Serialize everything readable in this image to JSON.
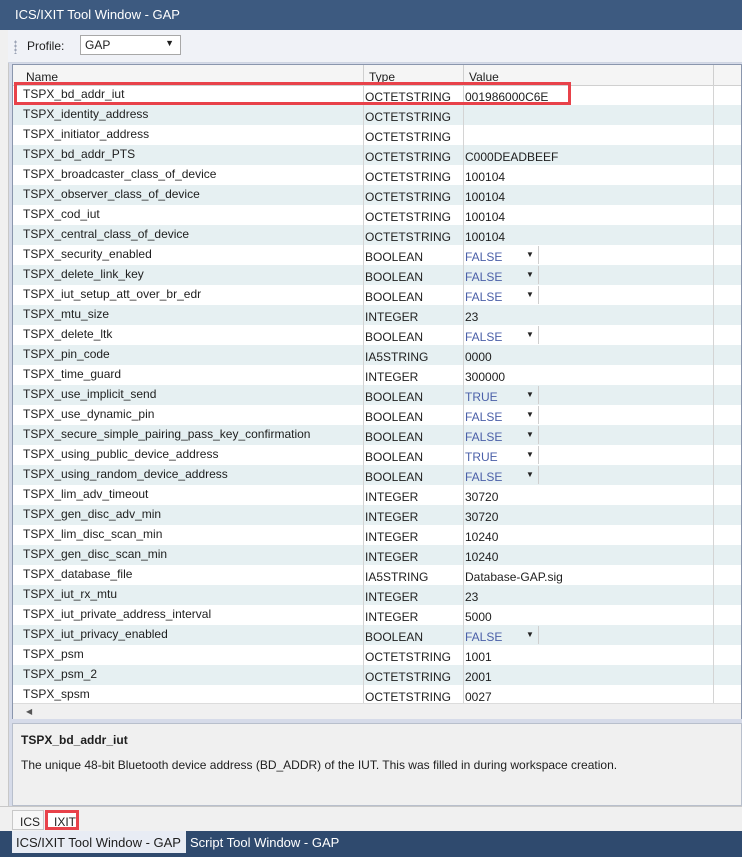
{
  "window": {
    "title": "ICS/IXIT Tool Window - GAP"
  },
  "toolbar": {
    "profile_label": "Profile:",
    "profile_value": "GAP"
  },
  "grid": {
    "columns": [
      "Name",
      "Type",
      "Value"
    ],
    "rows": [
      {
        "name": "TSPX_bd_addr_iut",
        "type": "OCTETSTRING",
        "value": "001986000C6E",
        "bool": false
      },
      {
        "name": "TSPX_identity_address",
        "type": "OCTETSTRING",
        "value": "",
        "bool": false
      },
      {
        "name": "TSPX_initiator_address",
        "type": "OCTETSTRING",
        "value": "",
        "bool": false
      },
      {
        "name": "TSPX_bd_addr_PTS",
        "type": "OCTETSTRING",
        "value": "C000DEADBEEF",
        "bool": false
      },
      {
        "name": "TSPX_broadcaster_class_of_device",
        "type": "OCTETSTRING",
        "value": "100104",
        "bool": false
      },
      {
        "name": "TSPX_observer_class_of_device",
        "type": "OCTETSTRING",
        "value": "100104",
        "bool": false
      },
      {
        "name": "TSPX_cod_iut",
        "type": "OCTETSTRING",
        "value": "100104",
        "bool": false
      },
      {
        "name": "TSPX_central_class_of_device",
        "type": "OCTETSTRING",
        "value": "100104",
        "bool": false
      },
      {
        "name": "TSPX_security_enabled",
        "type": "BOOLEAN",
        "value": "FALSE",
        "bool": true
      },
      {
        "name": "TSPX_delete_link_key",
        "type": "BOOLEAN",
        "value": "FALSE",
        "bool": true
      },
      {
        "name": "TSPX_iut_setup_att_over_br_edr",
        "type": "BOOLEAN",
        "value": "FALSE",
        "bool": true
      },
      {
        "name": "TSPX_mtu_size",
        "type": "INTEGER",
        "value": "23",
        "bool": false
      },
      {
        "name": "TSPX_delete_ltk",
        "type": "BOOLEAN",
        "value": "FALSE",
        "bool": true
      },
      {
        "name": "TSPX_pin_code",
        "type": "IA5STRING",
        "value": "0000",
        "bool": false
      },
      {
        "name": "TSPX_time_guard",
        "type": "INTEGER",
        "value": "300000",
        "bool": false
      },
      {
        "name": "TSPX_use_implicit_send",
        "type": "BOOLEAN",
        "value": "TRUE",
        "bool": true
      },
      {
        "name": "TSPX_use_dynamic_pin",
        "type": "BOOLEAN",
        "value": "FALSE",
        "bool": true
      },
      {
        "name": "TSPX_secure_simple_pairing_pass_key_confirmation",
        "type": "BOOLEAN",
        "value": "FALSE",
        "bool": true
      },
      {
        "name": "TSPX_using_public_device_address",
        "type": "BOOLEAN",
        "value": "TRUE",
        "bool": true
      },
      {
        "name": "TSPX_using_random_device_address",
        "type": "BOOLEAN",
        "value": "FALSE",
        "bool": true
      },
      {
        "name": "TSPX_lim_adv_timeout",
        "type": "INTEGER",
        "value": "30720",
        "bool": false
      },
      {
        "name": "TSPX_gen_disc_adv_min",
        "type": "INTEGER",
        "value": "30720",
        "bool": false
      },
      {
        "name": "TSPX_lim_disc_scan_min",
        "type": "INTEGER",
        "value": "10240",
        "bool": false
      },
      {
        "name": "TSPX_gen_disc_scan_min",
        "type": "INTEGER",
        "value": "10240",
        "bool": false
      },
      {
        "name": "TSPX_database_file",
        "type": "IA5STRING",
        "value": "Database-GAP.sig",
        "bool": false
      },
      {
        "name": "TSPX_iut_rx_mtu",
        "type": "INTEGER",
        "value": "23",
        "bool": false
      },
      {
        "name": "TSPX_iut_private_address_interval",
        "type": "INTEGER",
        "value": "5000",
        "bool": false
      },
      {
        "name": "TSPX_iut_privacy_enabled",
        "type": "BOOLEAN",
        "value": "FALSE",
        "bool": true
      },
      {
        "name": "TSPX_psm",
        "type": "OCTETSTRING",
        "value": "1001",
        "bool": false
      },
      {
        "name": "TSPX_psm_2",
        "type": "OCTETSTRING",
        "value": "2001",
        "bool": false
      },
      {
        "name": "TSPX_spsm",
        "type": "OCTETSTRING",
        "value": "0027",
        "bool": false
      }
    ]
  },
  "description": {
    "title": "TSPX_bd_addr_iut",
    "text": "The unique 48-bit Bluetooth device address (BD_ADDR) of the IUT. This was filled in during workspace creation."
  },
  "tabs": {
    "ics": "ICS",
    "ixit": "IXIT"
  },
  "bottom_tabs": {
    "active": "ICS/IXIT Tool Window - GAP",
    "inactive": "Script Tool Window - GAP"
  },
  "colors": {
    "highlight": "#e8424a",
    "title_bar": "#3d5a80",
    "row_alt": "#e6f0f2",
    "bool_value": "#4a5fa8"
  }
}
